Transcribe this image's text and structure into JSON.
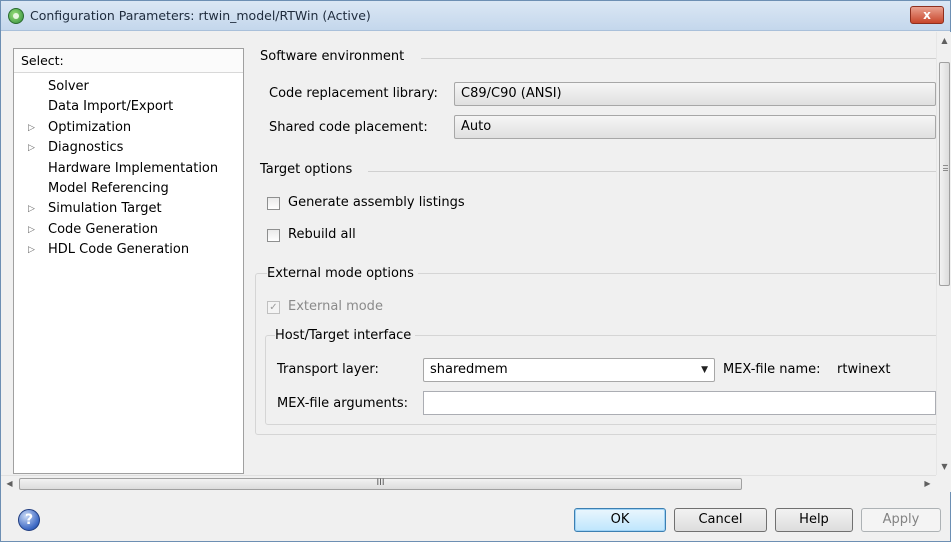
{
  "window": {
    "title": "Configuration Parameters: rtwin_model/RTWin (Active)",
    "close_glyph": "x"
  },
  "tree": {
    "header": "Select:",
    "items": [
      {
        "label": "Solver",
        "expandable": false
      },
      {
        "label": "Data Import/Export",
        "expandable": false
      },
      {
        "label": "Optimization",
        "expandable": true
      },
      {
        "label": "Diagnostics",
        "expandable": true
      },
      {
        "label": "Hardware Implementation",
        "expandable": false
      },
      {
        "label": "Model Referencing",
        "expandable": false
      },
      {
        "label": "Simulation Target",
        "expandable": true
      },
      {
        "label": "Code Generation",
        "expandable": true
      },
      {
        "label": "HDL Code Generation",
        "expandable": true
      }
    ],
    "expand_glyph": "▷"
  },
  "software_env": {
    "title": "Software environment",
    "code_repl_label": "Code replacement library:",
    "code_repl_value": "C89/C90 (ANSI)",
    "shared_code_label": "Shared code placement:",
    "shared_code_value": "Auto"
  },
  "target_options": {
    "title": "Target options",
    "gen_asm_label": "Generate assembly listings",
    "gen_asm_checked": false,
    "rebuild_label": "Rebuild all",
    "rebuild_checked": false
  },
  "external_mode": {
    "title": "External mode options",
    "ext_mode_label": "External mode",
    "ext_mode_checked": true,
    "check_glyph": "✓",
    "host_target_title": "Host/Target interface",
    "transport_label": "Transport layer:",
    "transport_value": "sharedmem",
    "mex_name_label": "MEX-file name:",
    "mex_name_value": "rtwinext",
    "mex_args_label": "MEX-file arguments:",
    "mex_args_value": ""
  },
  "scroll": {
    "up_glyph": "▲",
    "down_glyph": "▼",
    "left_glyph": "◀",
    "right_glyph": "▶",
    "h_thumb_grip": "III"
  },
  "buttons": {
    "help_glyph": "?",
    "ok": "OK",
    "cancel": "Cancel",
    "help": "Help",
    "apply": "Apply"
  }
}
